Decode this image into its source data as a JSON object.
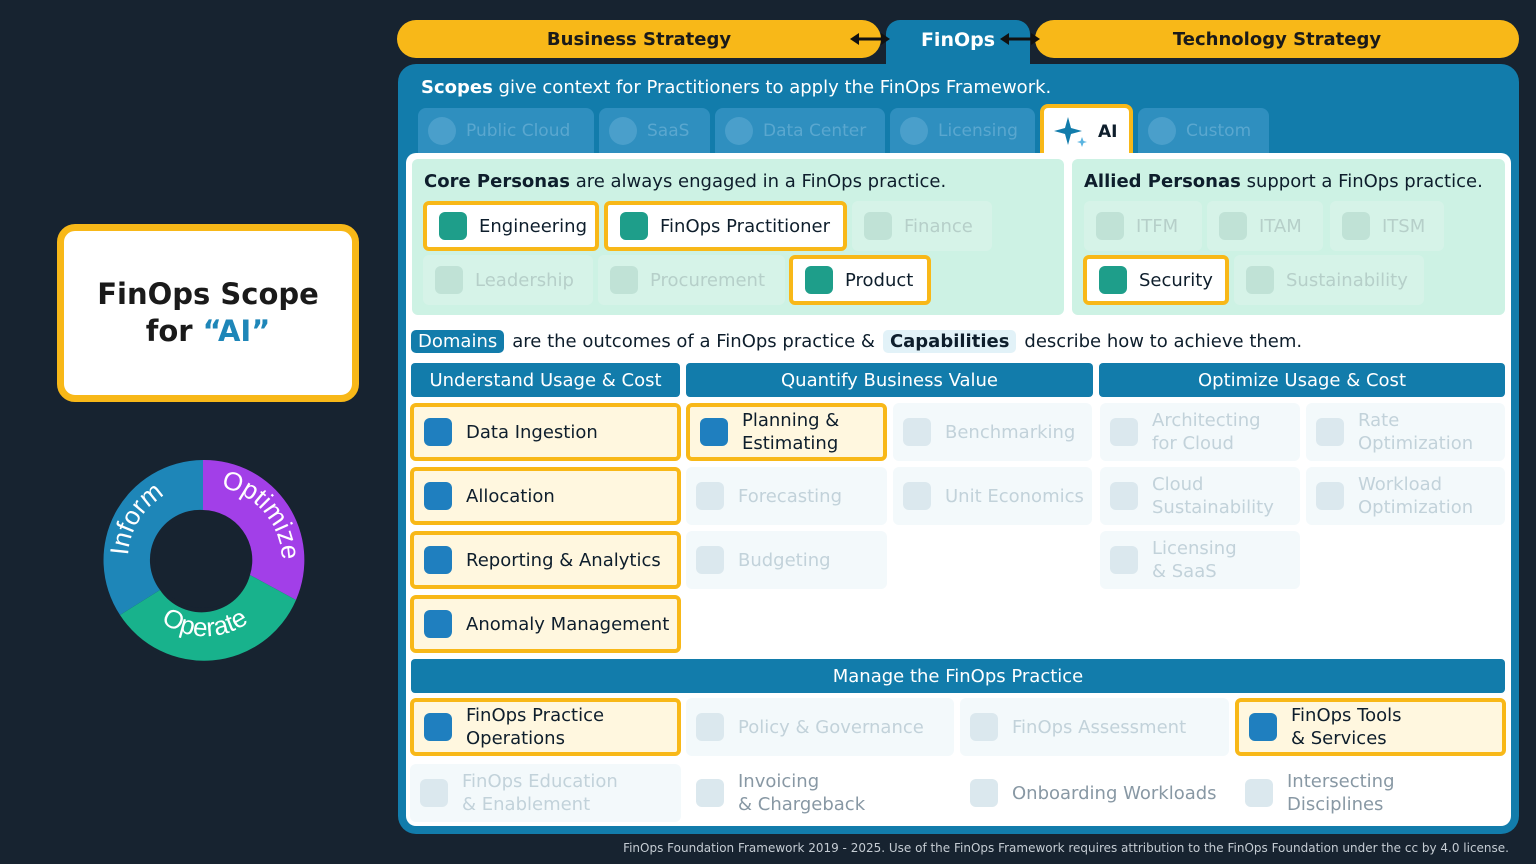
{
  "title_card": {
    "line1": "FinOps Scope",
    "line2_prefix": "for ",
    "line2_highlight": "“AI”"
  },
  "cycle": {
    "phases": [
      "Inform",
      "Optimize",
      "Operate"
    ],
    "colors": {
      "inform": "#1e86b8",
      "optimize": "#a23fe8",
      "operate": "#18b28c"
    }
  },
  "banner": {
    "business": "Business Strategy",
    "finops": "FinOps",
    "technology": "Technology Strategy"
  },
  "scopes": {
    "intro_bold": "Scopes",
    "intro_rest": " give context for Practitioners to apply the FinOps Framework.",
    "tabs": [
      {
        "label": "Public Cloud",
        "icon": "cloud-icon",
        "active": false
      },
      {
        "label": "SaaS",
        "icon": "saas-icon",
        "active": false
      },
      {
        "label": "Data Center",
        "icon": "server-icon",
        "active": false
      },
      {
        "label": "Licensing",
        "icon": "license-icon",
        "active": false
      },
      {
        "label": "AI",
        "icon": "sparkle-icon",
        "active": true
      },
      {
        "label": "Custom",
        "icon": "custom-icon",
        "active": false
      }
    ]
  },
  "core_personas": {
    "heading_bold": "Core Personas",
    "heading_rest": " are always engaged in a FinOps practice.",
    "items": [
      {
        "label": "Engineering",
        "active": true
      },
      {
        "label": "FinOps Practitioner",
        "active": true
      },
      {
        "label": "Finance",
        "active": false
      },
      {
        "label": "Leadership",
        "active": false
      },
      {
        "label": "Procurement",
        "active": false
      },
      {
        "label": "Product",
        "active": true
      }
    ]
  },
  "allied_personas": {
    "heading_bold": "Allied Personas",
    "heading_rest": " support a FinOps practice.",
    "items": [
      {
        "label": "ITFM",
        "active": false
      },
      {
        "label": "ITAM",
        "active": false
      },
      {
        "label": "ITSM",
        "active": false
      },
      {
        "label": "Security",
        "active": true
      },
      {
        "label": "Sustainability",
        "active": false
      }
    ]
  },
  "domains_line": {
    "domains_tag": "Domains",
    "middle": "are the outcomes of a FinOps practice &",
    "capabilities_tag": "Capabilities",
    "end": "describe how to achieve them."
  },
  "domains": [
    {
      "title": "Understand Usage & Cost"
    },
    {
      "title": "Quantify Business Value"
    },
    {
      "title": "Optimize Usage & Cost"
    }
  ],
  "capabilities": {
    "understand": [
      {
        "label": "Data Ingestion",
        "active": true
      },
      {
        "label": "Allocation",
        "active": true
      },
      {
        "label": "Reporting & Analytics",
        "active": true
      },
      {
        "label": "Anomaly Management",
        "active": true
      }
    ],
    "quantify": [
      {
        "label": "Planning &\nEstimating",
        "active": true
      },
      {
        "label": "Benchmarking",
        "active": false
      },
      {
        "label": "Forecasting",
        "active": false
      },
      {
        "label": "Unit Economics",
        "active": false
      },
      {
        "label": "Budgeting",
        "active": false
      }
    ],
    "optimize": [
      {
        "label": "Architecting\nfor Cloud",
        "active": false
      },
      {
        "label": "Rate\nOptimization",
        "active": false
      },
      {
        "label": "Cloud\nSustainability",
        "active": false
      },
      {
        "label": "Workload\nOptimization",
        "active": false
      },
      {
        "label": "Licensing\n& SaaS",
        "active": false
      }
    ]
  },
  "manage": {
    "title": "Manage the FinOps Practice",
    "items": [
      {
        "label": "FinOps Practice\nOperations",
        "active": true
      },
      {
        "label": "Policy & Governance",
        "active": false
      },
      {
        "label": "FinOps Assessment",
        "active": false
      },
      {
        "label": "FinOps Tools\n& Services",
        "active": true
      },
      {
        "label": "FinOps Education\n& Enablement",
        "active": false
      },
      {
        "label": "Invoicing\n& Chargeback",
        "active": false
      },
      {
        "label": "Onboarding Workloads",
        "active": false
      },
      {
        "label": "Intersecting\nDisciplines",
        "active": false
      }
    ]
  },
  "footer": "FinOps Foundation Framework 2019 - 2025. Use of the FinOps Framework requires attribution to the FinOps Foundation under the cc by 4.0 license.",
  "colors": {
    "accent_yellow": "#f8b818",
    "brand_blue": "#127cab",
    "background": "#172330"
  }
}
